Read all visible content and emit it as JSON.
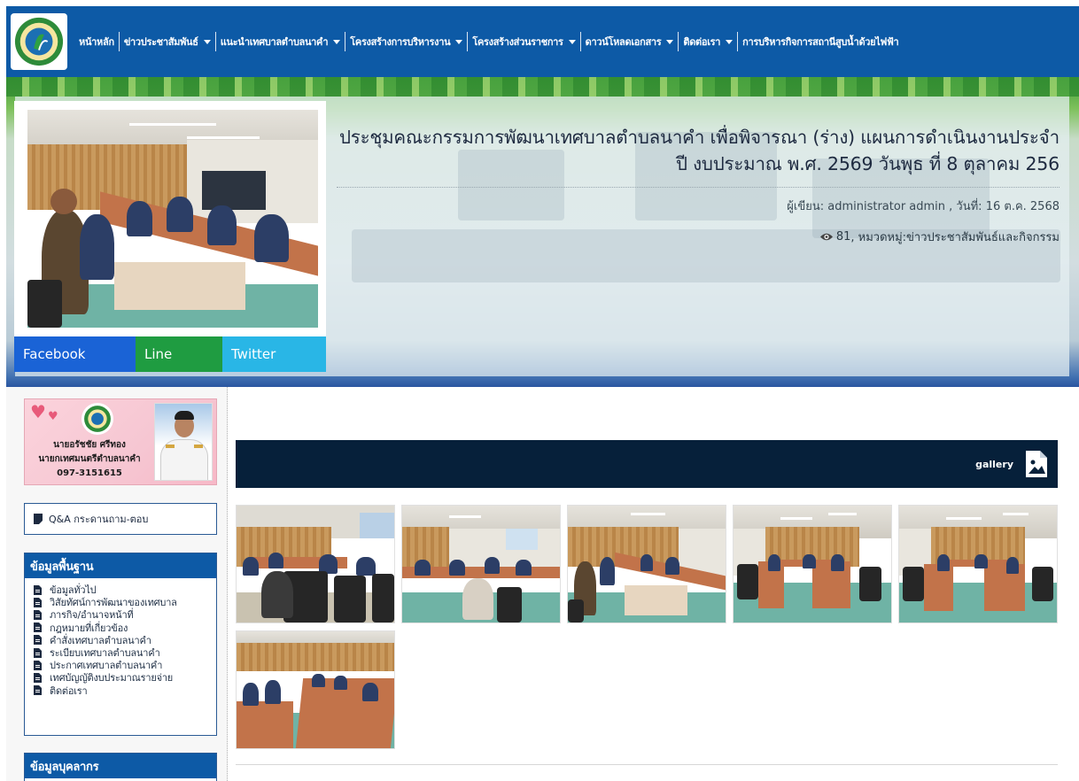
{
  "nav": {
    "items": [
      {
        "label": "หน้าหลัก",
        "dropdown": false
      },
      {
        "label": "ข่าวประชาสัมพันธ์",
        "dropdown": true
      },
      {
        "label": "แนะนำเทศบาลตำบลนาคำ",
        "dropdown": true
      },
      {
        "label": "โครงสร้างการบริหารงาน",
        "dropdown": true
      },
      {
        "label": "โครงสร้างส่วนราชการ",
        "dropdown": true
      },
      {
        "label": "ดาวน์โหลดเอกสาร",
        "dropdown": true
      },
      {
        "label": "ติดต่อเรา",
        "dropdown": true
      },
      {
        "label": "การบริหารกิจการสถานีสูบน้ำด้วยไฟฟ้า",
        "dropdown": false
      }
    ]
  },
  "article": {
    "title": "ประชุมคณะกรรมการพัฒนาเทศบาลตำบลนาคำ เพื่อพิจารณา (ร่าง) แผนการดำเนินงานประจำปี งบประมาณ พ.ศ. 2569 วันพุธ ที่ 8 ตุลาคม 256",
    "author_line": "ผู้เขียน: administrator admin , วันที่: 16 ต.ค. 2568",
    "views": "81",
    "category_prefix": ", หมวดหมู่:",
    "category": "ข่าวประชาสัมพันธ์และกิจกรรม"
  },
  "share": {
    "facebook": "Facebook",
    "line": "Line",
    "twitter": "Twitter"
  },
  "sidebar": {
    "mayor": {
      "name": "นายอรัชชัย ศรีทอง",
      "position": "นายกเทศมนตรีตำบลนาคำ",
      "phone": "097-3151615"
    },
    "qa_label": "Q&A กระดานถาม-ตอบ",
    "basic_info": {
      "heading": "ข้อมูลพื้นฐาน",
      "items": [
        "ข้อมูลทั่วไป",
        "วิสัยทัศน์การพัฒนาของเทศบาล",
        "ภารกิจ/อำนาจหน้าที่",
        "กฎหมายที่เกี่ยวข้อง",
        "คำสั่งเทศบาลตำบลนาคำ",
        "ระเบียบเทศบาลตำบลนาคำ",
        "ประกาศเทศบาลตำบลนาคำ",
        "เทศบัญญัติงบประมาณรายจ่าย",
        "ติดต่อเรา"
      ]
    },
    "personnel": {
      "heading": "ข้อมูลบุคลากร"
    }
  },
  "gallery": {
    "label": "gallery",
    "photo_count": 6
  },
  "colors": {
    "nav_bg": "#0d5aa6",
    "gallery_bar": "#06203a",
    "facebook": "#1a63d6",
    "line": "#1f9c41",
    "twitter": "#29b6e6"
  }
}
